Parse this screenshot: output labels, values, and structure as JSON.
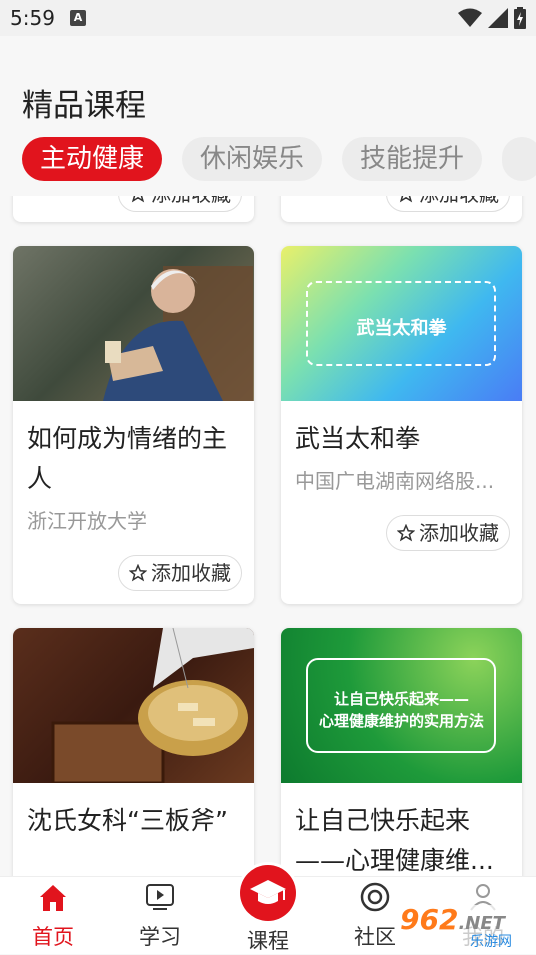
{
  "status_bar": {
    "time": "5:59",
    "notification_letter": "A"
  },
  "page_title": "精品课程",
  "tabs": [
    {
      "label": "主动健康",
      "active": true
    },
    {
      "label": "休闲娱乐",
      "active": false
    },
    {
      "label": "技能提升",
      "active": false
    }
  ],
  "favorite_label": "添加收藏",
  "cards": [
    {
      "title": "如何成为情绪的主人",
      "source": "浙江开放大学"
    },
    {
      "title": "武当太和拳",
      "source": "中国广电湖南网络股...",
      "thumb_text": "武当太和拳"
    },
    {
      "title": "沈氏女科“三板斧”",
      "source": ""
    },
    {
      "title": "让自己快乐起来——心理健康维...",
      "source": "",
      "thumb_text_line1": "让自己快乐起来——",
      "thumb_text_line2": "心理健康维护的实用方法"
    }
  ],
  "bottom_nav": [
    {
      "label": "首页",
      "icon": "home-icon",
      "active": true
    },
    {
      "label": "学习",
      "icon": "video-icon",
      "active": false
    },
    {
      "label": "课程",
      "icon": "graduation-cap-icon",
      "active": false
    },
    {
      "label": "社区",
      "icon": "community-icon",
      "active": false
    },
    {
      "label": "我的",
      "icon": "user-icon",
      "active": false
    }
  ],
  "watermark": {
    "text": "962",
    "suffix": ".NET",
    "sub": "乐游网"
  },
  "colors": {
    "accent": "#e1141d"
  }
}
